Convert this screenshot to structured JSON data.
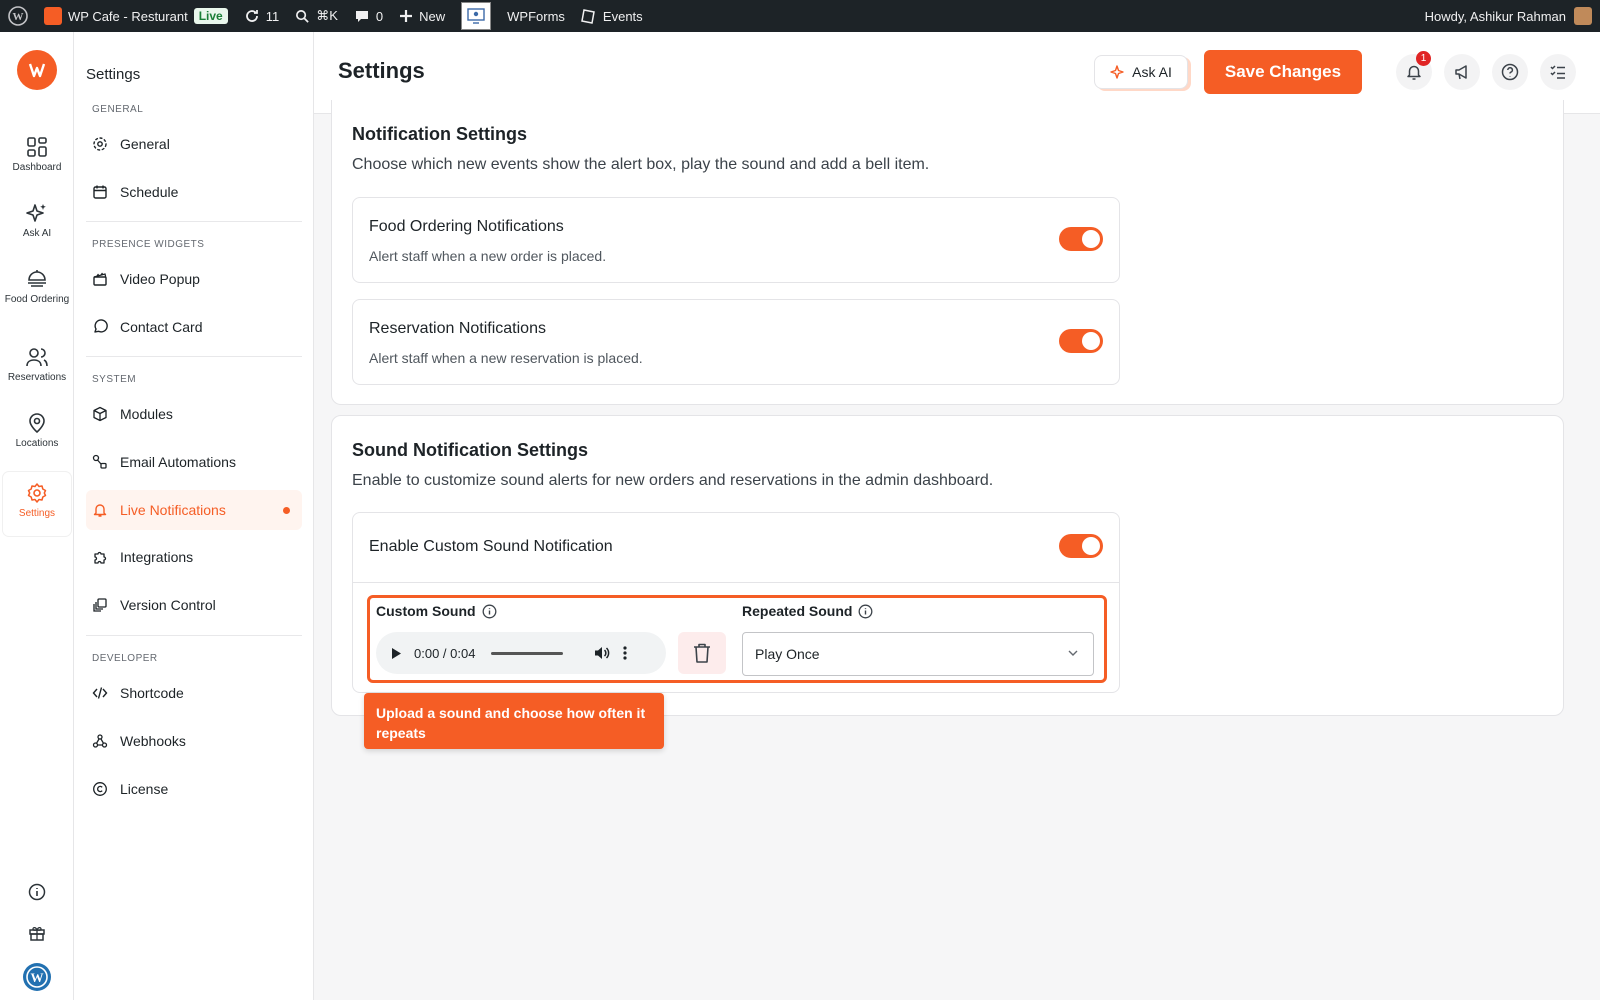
{
  "adminbar": {
    "site_name": "WP Cafe - Resturant",
    "live_badge": "Live",
    "updates_count": "11",
    "search_shortcut": "⌘K",
    "comments_count": "0",
    "new_label": "New",
    "wpforms_label": "WPForms",
    "events_label": "Events",
    "howdy": "Howdy, Ashikur Rahman"
  },
  "rail": {
    "items": [
      {
        "label": "Dashboard",
        "icon": "dashboard-icon"
      },
      {
        "label": "Ask AI",
        "icon": "sparkle-icon"
      },
      {
        "label": "Food Ordering",
        "icon": "food-ordering-icon"
      },
      {
        "label": "Reservations",
        "icon": "users-icon"
      },
      {
        "label": "Locations",
        "icon": "location-icon"
      },
      {
        "label": "Settings",
        "icon": "gear-icon"
      }
    ]
  },
  "nav": {
    "title": "Settings",
    "groups": {
      "general": "GENERAL",
      "presence": "PRESENCE WIDGETS",
      "system": "SYSTEM",
      "developer": "DEVELOPER"
    },
    "items": {
      "general": "General",
      "schedule": "Schedule",
      "video_popup": "Video Popup",
      "contact_card": "Contact Card",
      "modules": "Modules",
      "email_automations": "Email Automations",
      "live_notifications": "Live Notifications",
      "integrations": "Integrations",
      "version_control": "Version Control",
      "shortcode": "Shortcode",
      "webhooks": "Webhooks",
      "license": "License"
    }
  },
  "header": {
    "title": "Settings",
    "ask_ai": "Ask AI",
    "save": "Save Changes",
    "notification_count": "1"
  },
  "notification_settings": {
    "title": "Notification Settings",
    "description": "Choose which new events show the alert box, play the sound and add a bell item.",
    "rows": [
      {
        "title": "Food Ordering Notifications",
        "description": "Alert staff when a new order is placed.",
        "enabled": true
      },
      {
        "title": "Reservation Notifications",
        "description": "Alert staff when a new reservation is placed.",
        "enabled": true
      }
    ]
  },
  "sound_settings": {
    "title": "Sound Notification Settings",
    "description": "Enable to customize sound alerts for new orders and reservations in the admin dashboard.",
    "enable_label": "Enable Custom Sound Notification",
    "custom_sound_label": "Custom Sound",
    "audio_time": "0:00 / 0:04",
    "repeated_sound_label": "Repeated Sound",
    "repeated_sound_value": "Play Once"
  },
  "tooltip": {
    "text": "Upload a sound and choose how often it repeats"
  },
  "colors": {
    "accent": "#f55d25",
    "adminbar": "#1d2327"
  }
}
